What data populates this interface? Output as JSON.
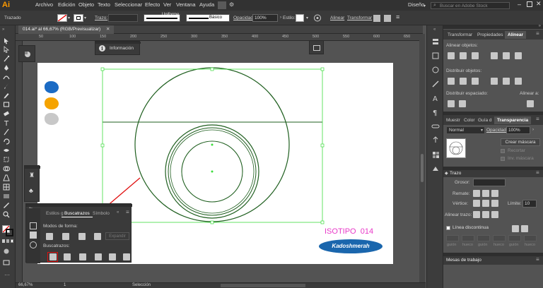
{
  "app": {
    "logo": "Ai"
  },
  "menu": [
    "Archivo",
    "Edición",
    "Objeto",
    "Texto",
    "Seleccionar",
    "Efecto",
    "Ver",
    "Ventana",
    "Ayuda"
  ],
  "workspace": {
    "label": "Diseño",
    "search_placeholder": "Buscar en Adobe Stock"
  },
  "control": {
    "mode": "Trazado",
    "stroke_label": "Trazo:",
    "stroke_profile": "Uniforme",
    "brush": "Básico",
    "opacity_label": "Opacidad:",
    "opacity_value": "100%",
    "style_label": "Estilo:",
    "align": "Alinear",
    "transform": "Transformar"
  },
  "doc_tab": "014.ai* al 66,67% (RGB/Previsualizar)",
  "info_label": "Información",
  "ruler_labels": [
    "50",
    "100",
    "150",
    "200",
    "250",
    "300",
    "350",
    "400",
    "450",
    "500",
    "550",
    "600",
    "650"
  ],
  "artboard": {
    "title": "ISOTIPO  014",
    "badge": "Kadoshmerah"
  },
  "swatches": [
    "#1b6bc4",
    "#f5a300",
    "#c8c8c8"
  ],
  "colors": {
    "selection": "#3ddc3d",
    "stroke": "#1f5f1f",
    "arrow": "#e01010",
    "title": "#e838c8",
    "badge": "#1a66ad"
  },
  "pathfinder": {
    "tabs": [
      "Estilos g",
      "Buscatrazos",
      "Símbolo"
    ],
    "modes_label": "Modos de forma:",
    "expand_label": "Expandir",
    "pathfinders_label": "Buscatrazos:"
  },
  "right_panel": {
    "tabs1": [
      "Transformar",
      "Propiedades",
      "Alinear"
    ],
    "align_objects": "Alinear objetos:",
    "distribute_objects": "Distribuir objetos:",
    "distribute_spacing": "Distribuir espaciado:",
    "align_to": "Alinear a:",
    "tabs2": [
      "Muestr",
      "Color",
      "Guía d",
      "Transparencia"
    ],
    "blend": "Normal",
    "opacity_label": "Opacidad:",
    "opacity_value": "100%",
    "make_mask": "Crear máscara",
    "clip": "Recortar",
    "invert": "Inv. máscara",
    "stroke_title": "Trazo",
    "weight_label": "Grosor:",
    "cap_label": "Remate:",
    "corner_label": "Vértice:",
    "limit_label": "Límite:",
    "limit_value": "10",
    "align_stroke_label": "Alinear trazo:",
    "dashed_label": "Línea discontinua",
    "dash_labels": [
      "guión",
      "hueco",
      "guión",
      "hueco",
      "guión",
      "hueco"
    ],
    "artboards_title": "Mesas de trabajo"
  },
  "status": {
    "zoom": "66,67%",
    "page": "1",
    "tool": "Selección"
  }
}
